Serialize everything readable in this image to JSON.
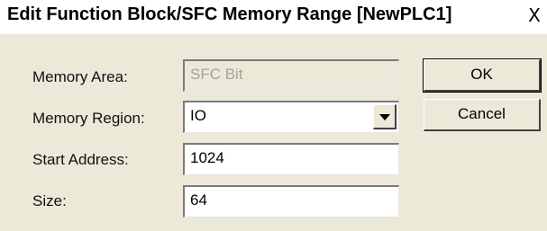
{
  "window": {
    "title": "Edit Function Block/SFC Memory Range [NewPLC1]",
    "close_glyph": "X"
  },
  "form": {
    "memory_area": {
      "label": "Memory Area:",
      "value": "SFC Bit",
      "disabled": true
    },
    "memory_region": {
      "label": "Memory Region:",
      "value": "IO"
    },
    "start_address": {
      "label": "Start Address:",
      "value": "1024"
    },
    "size": {
      "label": "Size:",
      "value": "64"
    }
  },
  "buttons": {
    "ok_label": "OK",
    "cancel_label": "Cancel"
  }
}
